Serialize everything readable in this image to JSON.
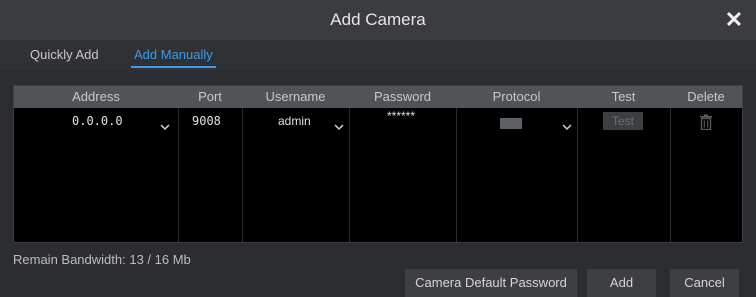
{
  "dialog": {
    "title": "Add Camera",
    "close_icon": "close-icon"
  },
  "tabs": [
    {
      "label": "Quickly Add",
      "active": false
    },
    {
      "label": "Add Manually",
      "active": true
    }
  ],
  "table": {
    "columns": [
      "Address",
      "Port",
      "Username",
      "Password",
      "Protocol",
      "Test",
      "Delete"
    ],
    "rows": [
      {
        "address": "0.0.0.0",
        "port": "9008",
        "username": "admin",
        "password": "******",
        "protocol": "",
        "test_label": "Test",
        "delete_icon": "trash-icon"
      }
    ]
  },
  "footer": {
    "bandwidth": "Remain Bandwidth: 13 / 16 Mb",
    "default_password_label": "Camera Default Password",
    "add_label": "Add",
    "cancel_label": "Cancel"
  },
  "colors": {
    "accent": "#3d9be9",
    "background": "#2b2d30",
    "table_bg": "#000000"
  }
}
